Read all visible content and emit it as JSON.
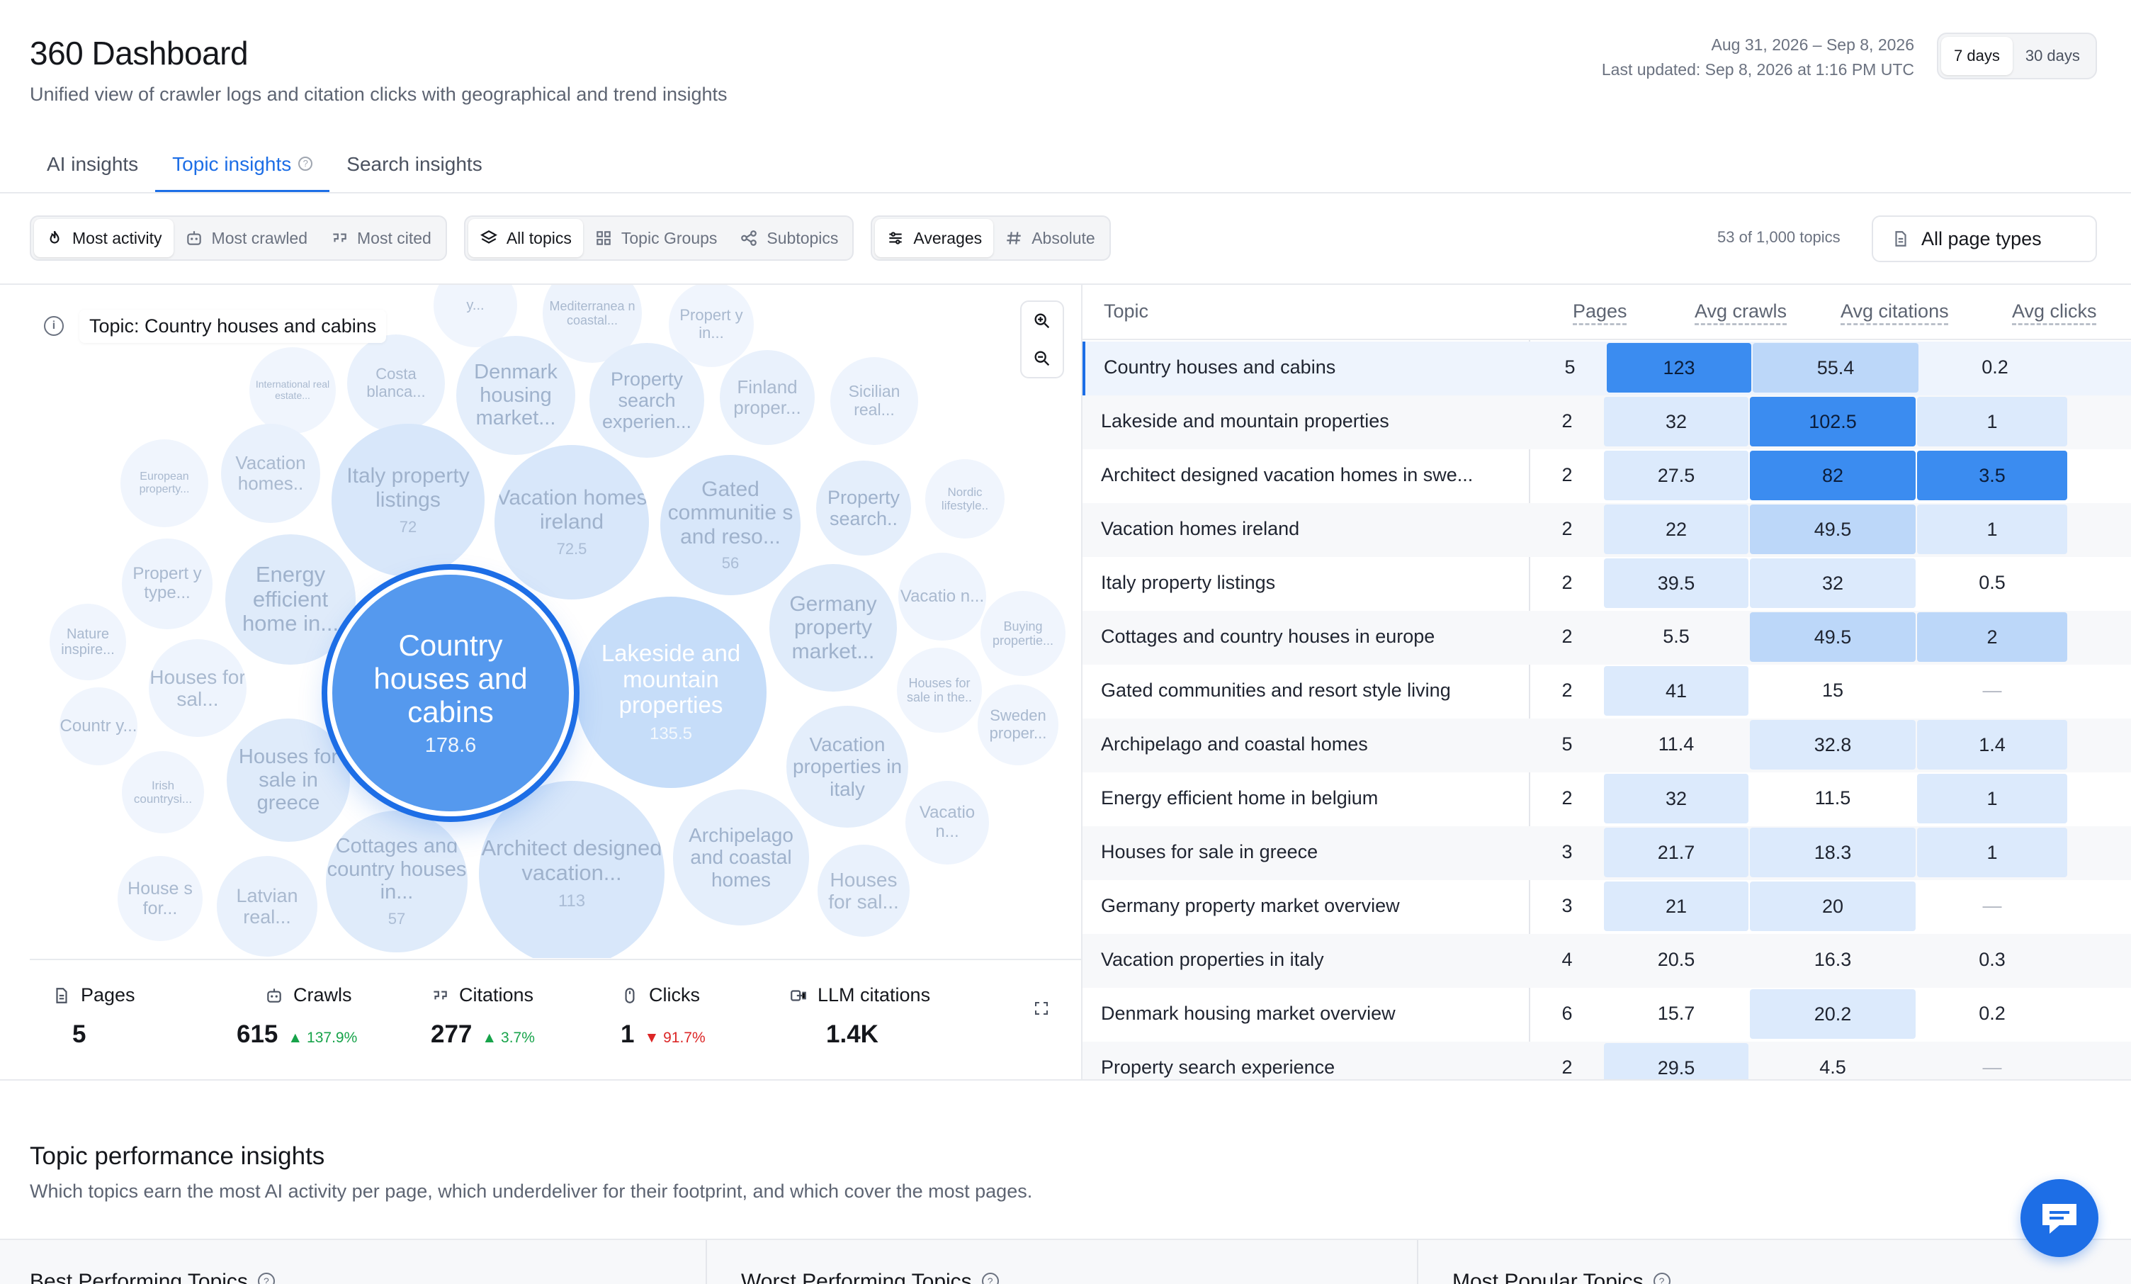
{
  "header": {
    "title": "360 Dashboard",
    "subtitle": "Unified view of crawler logs and citation clicks with geographical and trend insights",
    "date_range": "Aug 31, 2026 – Sep 8, 2026",
    "last_updated": "Last updated: Sep 8, 2026 at 1:16 PM UTC",
    "range_options": [
      "7 days",
      "30 days"
    ],
    "range_selected": "7 days"
  },
  "tabs": [
    {
      "label": "AI insights",
      "active": false
    },
    {
      "label": "Topic insights",
      "active": true,
      "help_icon": "question-icon"
    },
    {
      "label": "Search insights",
      "active": false
    }
  ],
  "toolbar": {
    "sort_group": [
      {
        "label": "Most activity",
        "icon": "flame-icon",
        "active": true
      },
      {
        "label": "Most crawled",
        "icon": "bot-icon",
        "active": false
      },
      {
        "label": "Most cited",
        "icon": "quote-icon",
        "active": false
      }
    ],
    "topic_group": [
      {
        "label": "All topics",
        "icon": "layers-icon",
        "active": true
      },
      {
        "label": "Topic Groups",
        "icon": "grid-icon",
        "active": false
      },
      {
        "label": "Subtopics",
        "icon": "nodes-icon",
        "active": false
      }
    ],
    "metric_group": [
      {
        "label": "Averages",
        "icon": "sliders-icon",
        "active": true
      },
      {
        "label": "Absolute",
        "icon": "hash-icon",
        "active": false
      }
    ],
    "topic_count": "53 of 1,000 topics",
    "page_type": "All page types"
  },
  "bubble_panel": {
    "selected_topic": "Topic: Country houses and cabins",
    "bubbles": [
      {
        "label": "y...",
        "value": ""
      },
      {
        "label": "Mediterranea n coastal...",
        "value": ""
      },
      {
        "label": "Propert y in...",
        "value": ""
      },
      {
        "label": "International real estate...",
        "value": ""
      },
      {
        "label": "Costa blanca...",
        "value": ""
      },
      {
        "label": "Denmark housing market...",
        "value": ""
      },
      {
        "label": "Property search experien...",
        "value": ""
      },
      {
        "label": "Finland proper...",
        "value": ""
      },
      {
        "label": "Sicilian real...",
        "value": ""
      },
      {
        "label": "European property...",
        "value": ""
      },
      {
        "label": "Vacation homes..",
        "value": ""
      },
      {
        "label": "Italy property listings",
        "value": "72"
      },
      {
        "label": "Vacation homes ireland",
        "value": "72.5"
      },
      {
        "label": "Gated communitie s and reso...",
        "value": "56"
      },
      {
        "label": "Property search..",
        "value": ""
      },
      {
        "label": "Nordic lifestyle..",
        "value": ""
      },
      {
        "label": "Propert y type...",
        "value": ""
      },
      {
        "label": "Energy efficient home in...",
        "value": ""
      },
      {
        "label": "Germany property market...",
        "value": ""
      },
      {
        "label": "Vacatio n...",
        "value": ""
      },
      {
        "label": "Nature inspire...",
        "value": ""
      },
      {
        "label": "Buying propertie...",
        "value": ""
      },
      {
        "label": "Houses for sal...",
        "value": ""
      },
      {
        "label": "Houses for sale in the..",
        "value": ""
      },
      {
        "label": "Countr y...",
        "value": ""
      },
      {
        "label": "Sweden proper...",
        "value": ""
      },
      {
        "label": "Irish countrysi...",
        "value": ""
      },
      {
        "label": "Houses for sale in greece",
        "value": ""
      },
      {
        "label": "Vacation properties in italy",
        "value": ""
      },
      {
        "label": "Vacatio n...",
        "value": ""
      },
      {
        "label": "House s for...",
        "value": ""
      },
      {
        "label": "Latvian real...",
        "value": ""
      },
      {
        "label": "Cottages and country houses in...",
        "value": "57"
      },
      {
        "label": "Architect designed vacation...",
        "value": "113"
      },
      {
        "label": "Archipelago and coastal homes",
        "value": ""
      },
      {
        "label": "Houses for sal...",
        "value": ""
      },
      {
        "label": "Lakeside and mountain properties",
        "value": "135.5"
      },
      {
        "label": "Country houses and cabins",
        "value": "178.6"
      }
    ]
  },
  "stats": [
    {
      "label": "Pages",
      "icon": "file-icon",
      "value": "5",
      "delta": "",
      "direction": ""
    },
    {
      "label": "Crawls",
      "icon": "bot-icon",
      "value": "615",
      "delta": "137.9%",
      "direction": "up"
    },
    {
      "label": "Citations",
      "icon": "quote-icon",
      "value": "277",
      "delta": "3.7%",
      "direction": "up"
    },
    {
      "label": "Clicks",
      "icon": "mouse-icon",
      "value": "1",
      "delta": "91.7%",
      "direction": "down"
    },
    {
      "label": "LLM citations",
      "icon": "link-icon",
      "value": "1.4K",
      "delta": "",
      "direction": ""
    }
  ],
  "table": {
    "columns": [
      "Topic",
      "Pages",
      "Avg crawls",
      "Avg citations",
      "Avg clicks"
    ],
    "rows": [
      [
        "Country houses and cabins",
        "5",
        "123",
        "55.4",
        "0.2"
      ],
      [
        "Lakeside and mountain properties",
        "2",
        "32",
        "102.5",
        "1"
      ],
      [
        "Architect designed vacation homes in swe...",
        "2",
        "27.5",
        "82",
        "3.5"
      ],
      [
        "Vacation homes ireland",
        "2",
        "22",
        "49.5",
        "1"
      ],
      [
        "Italy property listings",
        "2",
        "39.5",
        "32",
        "0.5"
      ],
      [
        "Cottages and country houses in europe",
        "2",
        "5.5",
        "49.5",
        "2"
      ],
      [
        "Gated communities and resort style living",
        "2",
        "41",
        "15",
        "—"
      ],
      [
        "Archipelago and coastal homes",
        "5",
        "11.4",
        "32.8",
        "1.4"
      ],
      [
        "Energy efficient home in belgium",
        "2",
        "32",
        "11.5",
        "1"
      ],
      [
        "Houses for sale in greece",
        "3",
        "21.7",
        "18.3",
        "1"
      ],
      [
        "Germany property market overview",
        "3",
        "21",
        "20",
        "—"
      ],
      [
        "Vacation properties in italy",
        "4",
        "20.5",
        "16.3",
        "0.3"
      ],
      [
        "Denmark housing market overview",
        "6",
        "15.7",
        "20.2",
        "0.2"
      ],
      [
        "Property search experience",
        "2",
        "29.5",
        "4.5",
        "—"
      ]
    ],
    "heat_colors": {
      "strong": "#3b8cf0",
      "mid": "#bcd7f9",
      "light": "#dceafc",
      "faint": "#edf4fd"
    }
  },
  "insights": {
    "title": "Topic performance insights",
    "subtitle": "Which topics earn the most AI activity per page, which underdeliver for their footprint, and which cover the most pages.",
    "cards": [
      "Best Performing Topics",
      "Worst Performing Topics",
      "Most Popular Topics"
    ]
  },
  "colors": {
    "accent": "#1d6ee6",
    "up": "#17a34a",
    "down": "#dc2626"
  }
}
